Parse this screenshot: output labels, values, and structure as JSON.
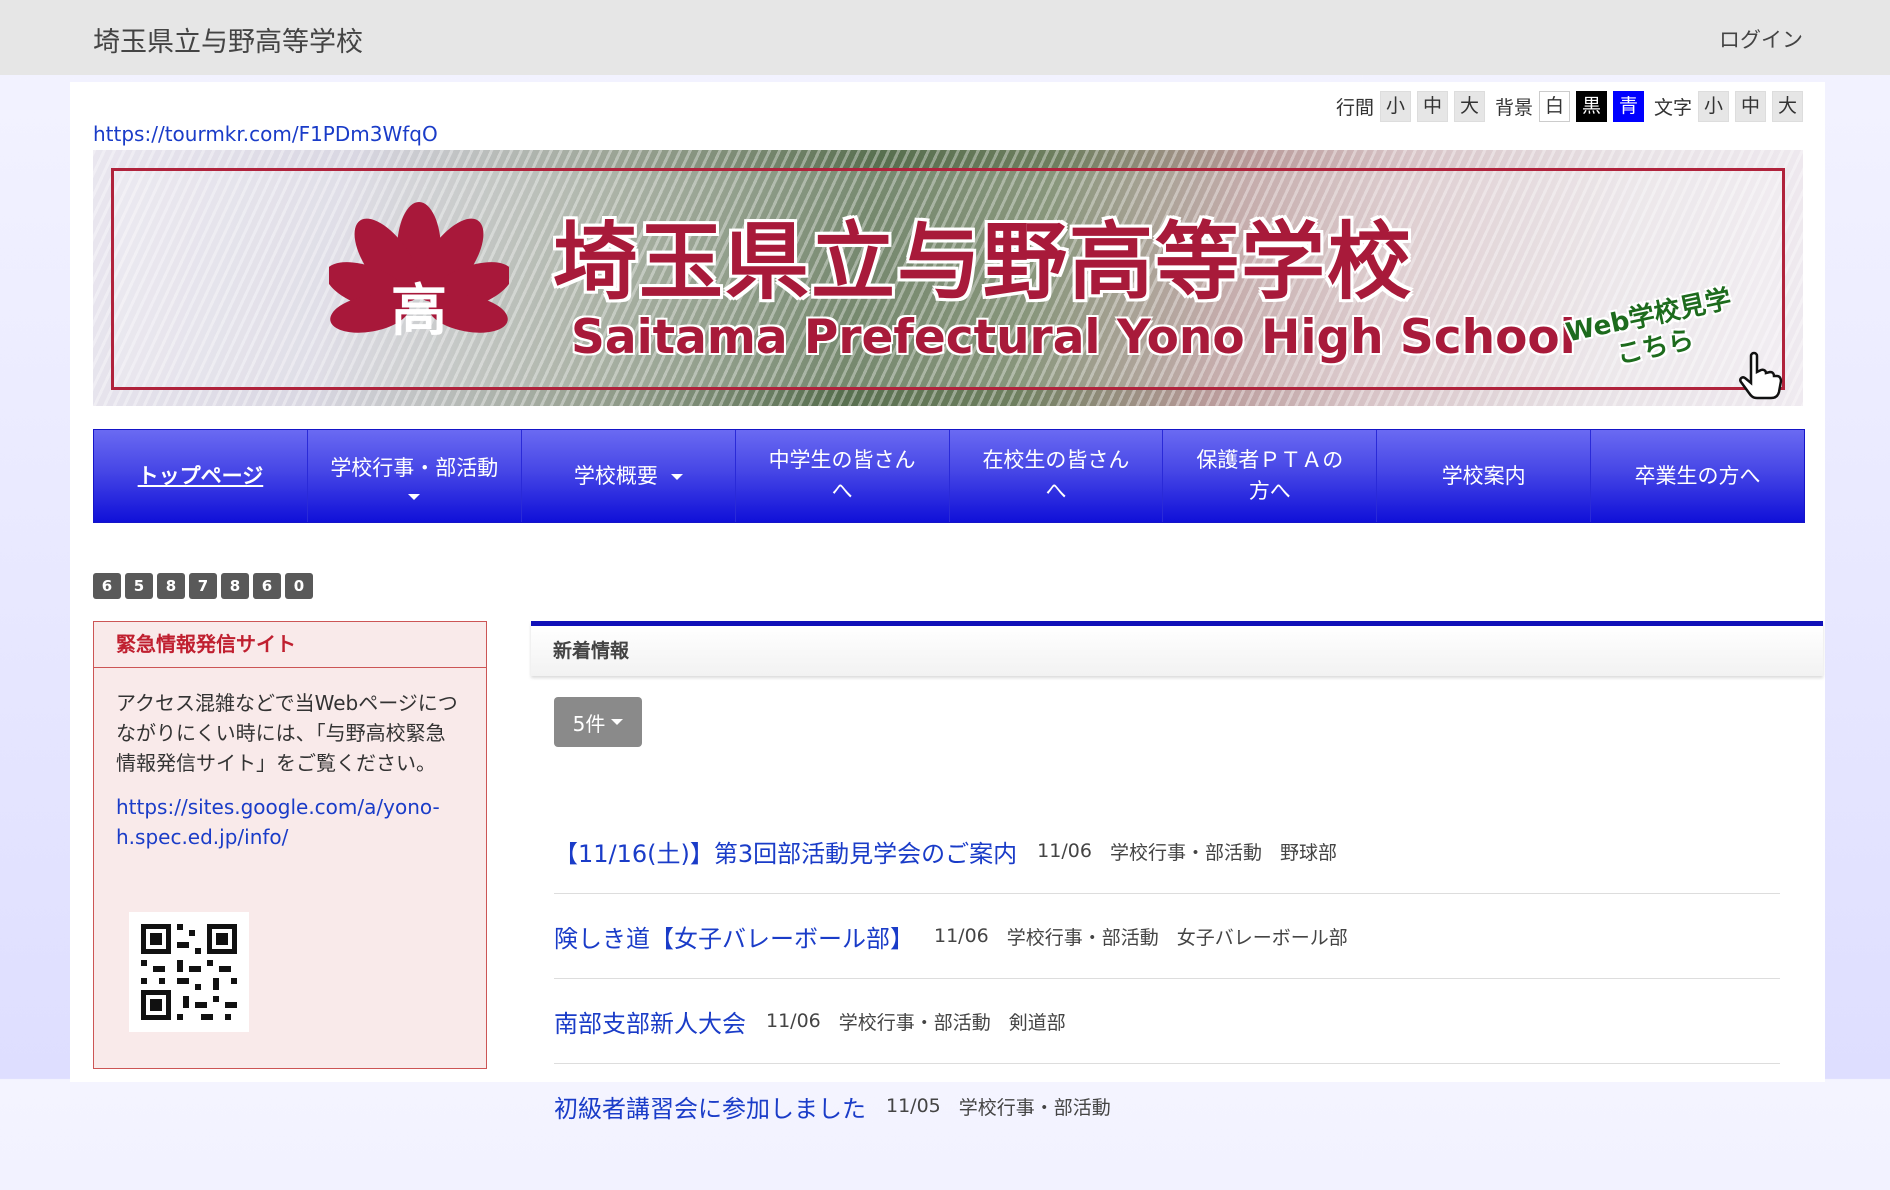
{
  "header": {
    "site_name": "埼玉県立与野高等学校",
    "login": "ログイン"
  },
  "a11y": {
    "line_label": "行間",
    "line_small": "小",
    "line_mid": "中",
    "line_large": "大",
    "bg_label": "背景",
    "bg_white": "白",
    "bg_black": "黒",
    "bg_blue": "青",
    "text_label": "文字",
    "text_small": "小",
    "text_mid": "中",
    "text_large": "大"
  },
  "tour_link": "https://tourmkr.com/F1PDm3WfqO",
  "banner": {
    "title": "埼玉県立与野高等学校",
    "subtitle": "Saitama Prefectural Yono High School",
    "badge_line1": "Web学校見学",
    "badge_line2": "こちら",
    "crest_char": "高"
  },
  "nav": {
    "items": [
      {
        "line1": "トップページ",
        "line2": ""
      },
      {
        "line1": "学校行事・部活動",
        "line2": ""
      },
      {
        "line1": "学校概要",
        "line2": ""
      },
      {
        "line1": "中学生の皆さん",
        "line2": "へ"
      },
      {
        "line1": "在校生の皆さん",
        "line2": "へ"
      },
      {
        "line1": "保護者ＰＴＡの",
        "line2": "方へ"
      },
      {
        "line1": "学校案内",
        "line2": ""
      },
      {
        "line1": "卒業生の方へ",
        "line2": ""
      }
    ]
  },
  "counter": [
    "6",
    "5",
    "8",
    "7",
    "8",
    "6",
    "0"
  ],
  "emergency": {
    "title": "緊急情報発信サイト",
    "body": "アクセス混雑などで当Webページにつながりにくい時には、「与野高校緊急情報発信サイト」をご覧ください。",
    "link": "https://sites.google.com/a/yono-h.spec.ed.jp/info/"
  },
  "news": {
    "heading": "新着情報",
    "count_label": "5件",
    "items": [
      {
        "title": "【11/16(土)】第3回部活動見学会のご案内",
        "date": "11/06",
        "category": "学校行事・部活動",
        "club": "野球部"
      },
      {
        "title": "険しき道【女子バレーボール部】",
        "date": "11/06",
        "category": "学校行事・部活動",
        "club": "女子バレーボール部"
      },
      {
        "title": "南部支部新人大会",
        "date": "11/06",
        "category": "学校行事・部活動",
        "club": "剣道部"
      },
      {
        "title": "初級者講習会に参加しました",
        "date": "11/05",
        "category": "学校行事・部活動",
        "club": ""
      }
    ]
  }
}
